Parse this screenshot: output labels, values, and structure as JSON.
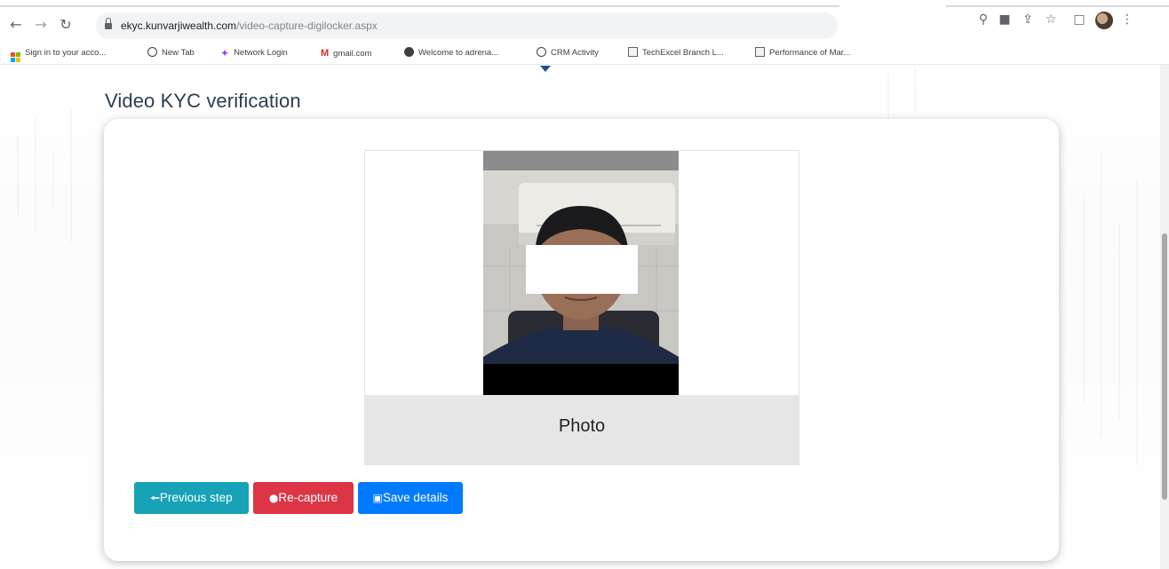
{
  "browser": {
    "url_host": "ekyc.kunvarjiwealth.com",
    "url_path": "/video-capture-digilocker.aspx",
    "nav_icons": [
      "back-arrow-icon",
      "forward-arrow-icon",
      "reload-icon"
    ],
    "toolbar_icons": [
      "location-pin-icon",
      "camera-icon",
      "share-icon",
      "star-icon",
      "sidebar-icon",
      "profile-avatar-icon",
      "more-menu-icon"
    ]
  },
  "bookmarks": [
    {
      "label": "Sign in to your acco...",
      "icon": "microsoft-icon"
    },
    {
      "label": "New Tab",
      "icon": "globe-icon"
    },
    {
      "label": "Network Login",
      "icon": "network-icon"
    },
    {
      "label": "gmail.com",
      "icon": "gmail-icon"
    },
    {
      "label": "Welcome to adrena...",
      "icon": "adrena-icon"
    },
    {
      "label": "CRM Activity",
      "icon": "globe-icon"
    },
    {
      "label": "TechExcel Branch L...",
      "icon": "techexcel-icon"
    },
    {
      "label": "Performance of Mar...",
      "icon": "chart-image-icon"
    }
  ],
  "page": {
    "title": "Video KYC verification",
    "photo_caption": "Photo",
    "buttons": {
      "previous_label": "Previous step",
      "recapture_label": "Re-capture",
      "save_label": "Save details"
    }
  },
  "colors": {
    "previous_button": "#17a2b8",
    "recapture_button": "#dc3545",
    "save_button": "#007bff",
    "title_text": "#2c3e50"
  }
}
